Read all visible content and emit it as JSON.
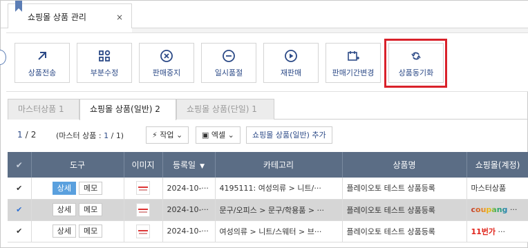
{
  "window_tab": {
    "title": "쇼핑몰 상품 관리",
    "close": "×"
  },
  "toolbar": {
    "buttons": [
      {
        "label": "상품전송",
        "icon": "arrow-up-right-icon"
      },
      {
        "label": "부분수정",
        "icon": "grid-shapes-icon"
      },
      {
        "label": "판매중지",
        "icon": "circle-x-icon"
      },
      {
        "label": "일시품절",
        "icon": "circle-minus-icon"
      },
      {
        "label": "재판매",
        "icon": "circle-play-icon"
      },
      {
        "label": "판매기간변경",
        "icon": "calendar-plus-icon"
      },
      {
        "label": "상품동기화",
        "icon": "sync-icon"
      }
    ],
    "highlight_color": "#d9212a"
  },
  "subtabs": [
    {
      "label": "마스터상품",
      "count": "1"
    },
    {
      "label": "쇼핑몰 상품(일반)",
      "count": "2"
    },
    {
      "label": "쇼핑몰 상품(단일)",
      "count": "1"
    }
  ],
  "actions": {
    "page_current": "1",
    "page_sep": "/",
    "page_total": "2",
    "master_count_prefix": "(마스터 상품 :",
    "master_count_n": "1",
    "master_count_sep": "/",
    "master_count_total": "1)",
    "work_label": "작업",
    "excel_label": "엑셀",
    "add_label": "쇼핑몰 상품(일반) 추가"
  },
  "table": {
    "headers": {
      "tool": "도구",
      "image": "이미지",
      "reg_date": "등록일",
      "category": "카테고리",
      "product_name": "상품명",
      "shop": "쇼핑몰(계정)"
    },
    "rows": [
      {
        "detail": "상세",
        "memo": "메모",
        "date": "2024-10-···",
        "category": "4195111: 여성의류 > 니트/···",
        "name": "플레이오토 테스트 상품등록",
        "shop": "마스터상품"
      },
      {
        "detail": "상세",
        "memo": "메모",
        "date": "2024-10-···",
        "category": "문구/오피스 > 문구/학용품 > ···",
        "name": "플레이오토 테스트 상품등록",
        "shop": "coupang",
        "shop_suffix": " ···"
      },
      {
        "detail": "상세",
        "memo": "메모",
        "date": "2024-10-···",
        "category": "여성의류 > 니트/스웨터 > 브···",
        "name": "플레이오토 테스트 상품등록",
        "shop": "11번가",
        "shop_suffix": " ···"
      }
    ]
  }
}
